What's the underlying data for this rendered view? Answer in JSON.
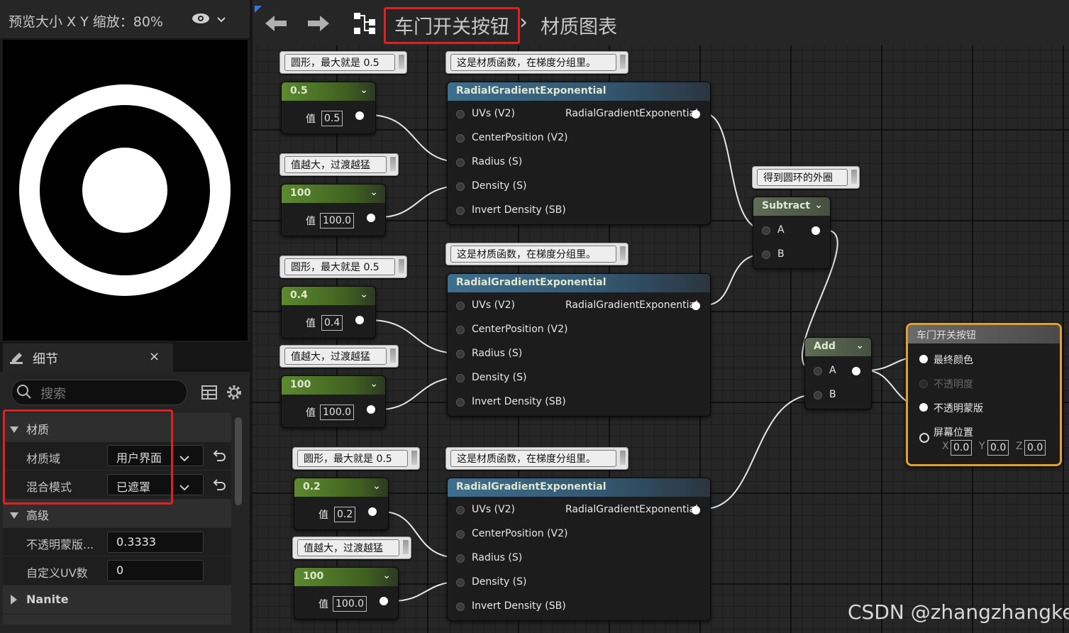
{
  "preview": {
    "title": "预览大小 X Y 缩放：80%",
    "eye_icon": "eye-icon",
    "dropdown_icon": "chevron-down-icon"
  },
  "details": {
    "tab_label": "细节",
    "close": "×",
    "search_placeholder": "搜索",
    "sections": {
      "material": "材质",
      "advanced": "高级",
      "nanite": "Nanite"
    },
    "props": {
      "material_domain_label": "材质域",
      "material_domain_value": "用户界面",
      "blend_mode_label": "混合模式",
      "blend_mode_value": "已遮罩",
      "opacity_mask_label": "不透明蒙版...",
      "opacity_mask_value": "0.3333",
      "custom_uv_label": "自定义UV数",
      "custom_uv_value": "0"
    }
  },
  "toolbar": {
    "back": "🡐",
    "forward": "🡒",
    "crumb_1": "车门开关按钮",
    "separator": "›",
    "crumb_2": "材质图表"
  },
  "comments": {
    "c1": "圆形，最大就是 0.5",
    "c2": "值越大，过渡越猛",
    "c3": "圆形，最大就是 0.5",
    "c4": "值越大，过渡越猛",
    "c5": "圆形，最大就是 0.5",
    "c6": "值越大，过渡越猛",
    "f1": "这是材质函数，在梯度分组里。",
    "f2": "这是材质函数，在梯度分组里。",
    "f3": "这是材质函数，在梯度分组里。",
    "outer": "得到圆环的外圈"
  },
  "constants": [
    {
      "title": "0.5",
      "label": "值",
      "value": "0.5"
    },
    {
      "title": "100",
      "label": "值",
      "value": "100.0"
    },
    {
      "title": "0.4",
      "label": "值",
      "value": "0.4"
    },
    {
      "title": "100",
      "label": "值",
      "value": "100.0"
    },
    {
      "title": "0.2",
      "label": "值",
      "value": "0.2"
    },
    {
      "title": "100",
      "label": "值",
      "value": "100.0"
    }
  ],
  "radial": {
    "title": "RadialGradientExponential",
    "output": "RadialGradientExponential",
    "inputs": [
      "UVs (V2)",
      "CenterPosition (V2)",
      "Radius (S)",
      "Density (S)",
      "Invert Density (SB)"
    ]
  },
  "subtract": {
    "title": "Subtract",
    "a": "A",
    "b": "B"
  },
  "add": {
    "title": "Add",
    "a": "A",
    "b": "B"
  },
  "result": {
    "title": "车门开关按钮",
    "final_color": "最终颜色",
    "opacity": "不透明度",
    "opacity_mask": "不透明蒙版",
    "screen_position": "屏幕位置",
    "x_label": "X",
    "x": "0.0",
    "y_label": "Y",
    "y": "0.0",
    "z_label": "Z",
    "z": "0.0"
  },
  "watermark": "CSDN @zhangzhangkeji",
  "colors": {
    "highlight": "#e02020",
    "result_border": "#e0a030"
  }
}
